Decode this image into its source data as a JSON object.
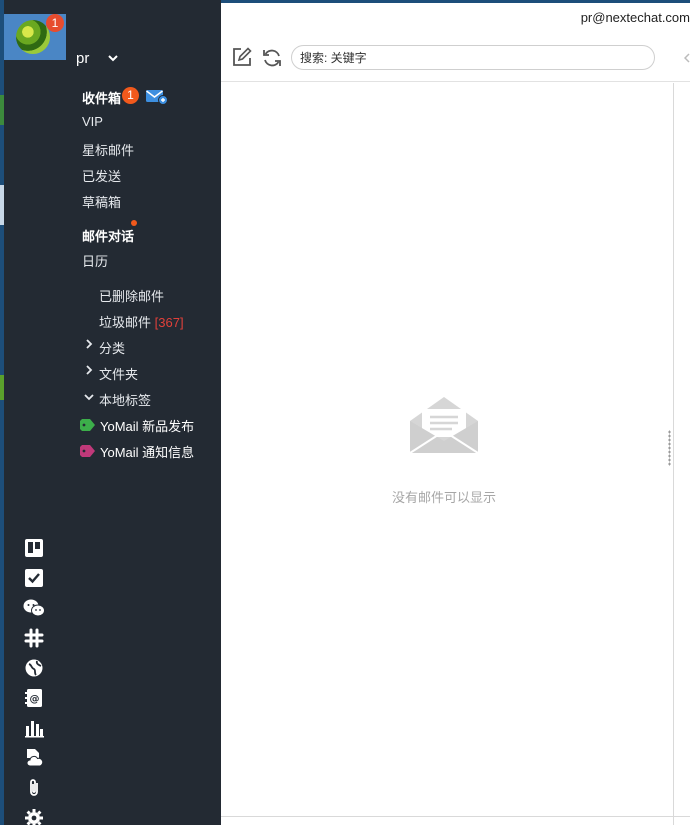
{
  "account": {
    "name": "pr",
    "email": "pr@nextechat.com",
    "notification_count": "1"
  },
  "folders": {
    "inbox": {
      "label": "收件箱",
      "count": "1"
    },
    "vip": "VIP",
    "starred": "星标邮件",
    "sent": "已发送",
    "drafts": "草稿箱",
    "conversations": "邮件对话",
    "calendar": "日历",
    "deleted": "已删除邮件",
    "spam": {
      "label": "垃圾邮件",
      "count": "[367]"
    },
    "categories": "分类",
    "folders": "文件夹",
    "local_tags": "本地标签"
  },
  "tags": [
    {
      "label": "YoMail 新品发布",
      "color": "#3cae4a"
    },
    {
      "label": "YoMail 通知信息",
      "color": "#c0397a"
    }
  ],
  "app_icons": [
    "trello-icon",
    "checklist-icon",
    "wechat-icon",
    "slack-icon",
    "globe-icon",
    "contacts-icon",
    "chart-icon",
    "cloud-file-icon",
    "attachment-icon",
    "settings-icon"
  ],
  "search": {
    "placeholder": "搜索: 关键字"
  },
  "main": {
    "empty_message": "没有邮件可以显示"
  },
  "colors": {
    "sidebar_bg": "#232a33",
    "accent_badge": "#f1591c",
    "spam_count": "#e0403a",
    "avatar_highlight": "#4a86c5"
  }
}
